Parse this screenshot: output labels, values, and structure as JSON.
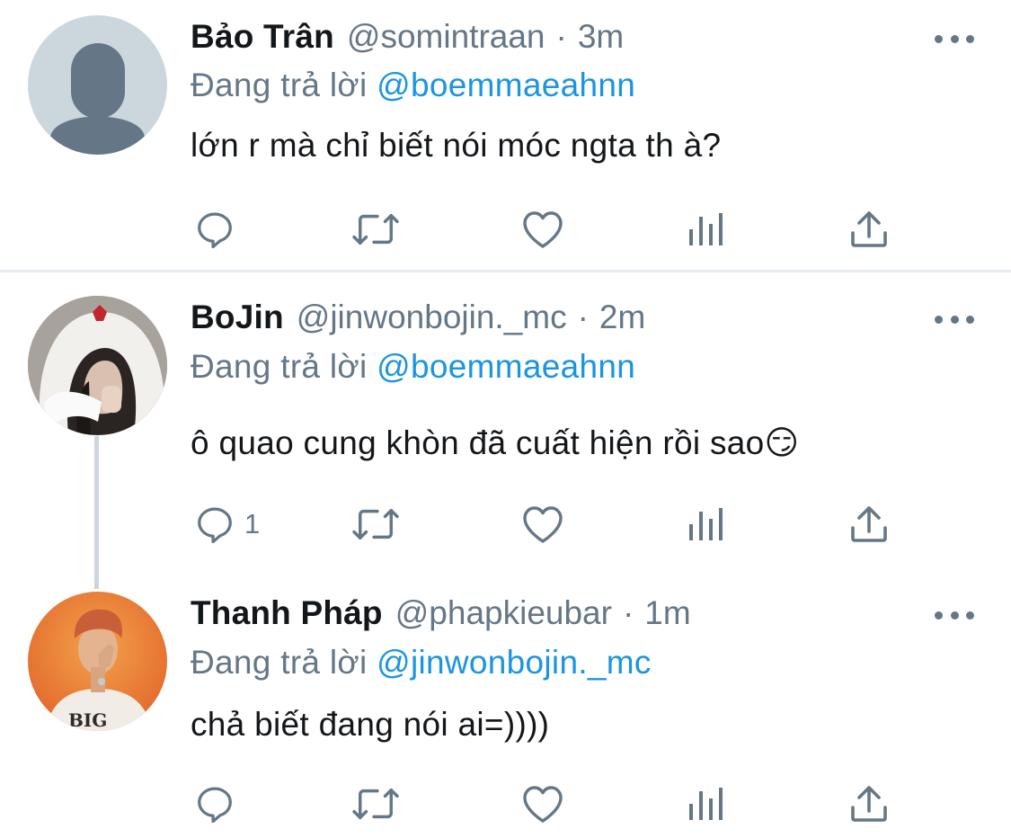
{
  "colors": {
    "text": "#14171a",
    "secondary": "#657786",
    "link": "#1b95e0",
    "divider": "#e6ecf0",
    "thread_line": "#ccd6dd"
  },
  "tweets": [
    {
      "name": "Bảo Trân",
      "handle": "@somintraan",
      "separator": "·",
      "time": "3m",
      "replying_prefix": "Đang trả lời",
      "replying_to": "@boemmaeahnn",
      "text": "lớn r mà chỉ biết nói móc ngta th à?",
      "reply_count": "",
      "avatar": "default-avatar-icon"
    },
    {
      "name": "BoJin",
      "handle": "@jinwonbojin._mc",
      "separator": "·",
      "time": "2m",
      "replying_prefix": "Đang trả lời",
      "replying_to": "@boemmaeahnn",
      "text": "ô quao cung khòn đã cuất hiện rồi sao😏",
      "reply_count": "1",
      "avatar": "hooded-person-avatar"
    },
    {
      "name": "Thanh Pháp",
      "handle": "@phapkieubar",
      "separator": "·",
      "time": "1m",
      "replying_prefix": "Đang trả lời",
      "replying_to": "@jinwonbojin._mc",
      "text": "chả biết đang nói ai=))))",
      "reply_count": "",
      "avatar": "orange-background-person-avatar"
    }
  ],
  "action_icons": [
    "reply-icon",
    "retweet-icon",
    "like-icon",
    "analytics-icon",
    "share-icon"
  ]
}
